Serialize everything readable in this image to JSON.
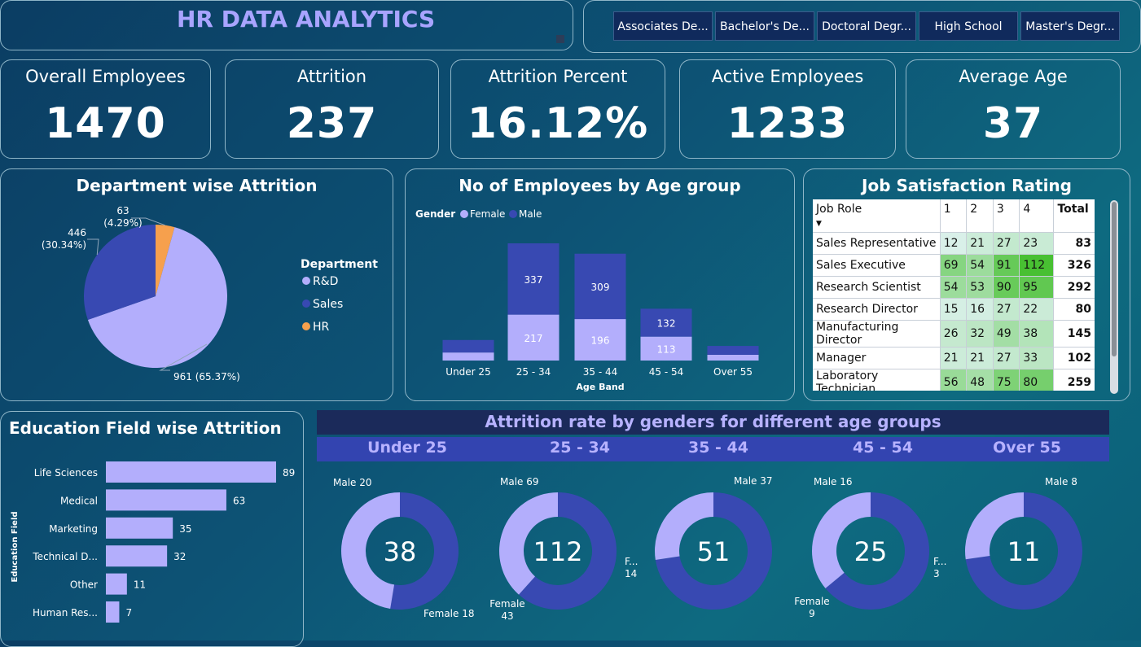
{
  "header": {
    "title": "HR DATA ANALYTICS"
  },
  "slicers": [
    "Associates De...",
    "Bachelor's De...",
    "Doctoral Degr...",
    "High School",
    "Master's Degr..."
  ],
  "kpis": [
    {
      "label": "Overall Employees",
      "value": "1470"
    },
    {
      "label": "Attrition",
      "value": "237"
    },
    {
      "label": "Attrition Percent",
      "value": "16.12%"
    },
    {
      "label": "Active Employees",
      "value": "1233"
    },
    {
      "label": "Average Age",
      "value": "37"
    }
  ],
  "colors": {
    "rnd": "#b3aefc",
    "sales": "#3849b2",
    "hr": "#f6a04d",
    "female": "#b3aefc",
    "male": "#3849b2"
  },
  "dept_title": "Department wise Attrition",
  "age_title": "No of Employees by Age group",
  "jobsat_title": "Job Satisfaction Rating",
  "edu_title": "Education Field wise Attrition",
  "gender_title": "Attrition rate by genders for different age groups",
  "chart_data": [
    {
      "type": "pie",
      "title": "Department wise Attrition",
      "legend_title": "Department",
      "slices": [
        {
          "name": "R&D",
          "value": 961,
          "label": "961 (65.37%)"
        },
        {
          "name": "Sales",
          "value": 446,
          "label": "446\n(30.34%)"
        },
        {
          "name": "HR",
          "value": 63,
          "label": "63\n(4.29%)"
        }
      ]
    },
    {
      "type": "bar",
      "stacked": true,
      "title": "No of Employees by Age group",
      "legend_title": "Gender",
      "xlabel": "Age Band",
      "categories": [
        "Under 25",
        "25 - 34",
        "35 - 44",
        "45 - 54",
        "Over 55"
      ],
      "series": [
        {
          "name": "Female",
          "values": [
            38,
            217,
            196,
            113,
            27
          ],
          "show_labels": [
            false,
            true,
            true,
            true,
            false
          ]
        },
        {
          "name": "Male",
          "values": [
            59,
            337,
            309,
            132,
            42
          ],
          "show_labels": [
            false,
            true,
            true,
            true,
            false
          ]
        }
      ]
    },
    {
      "type": "table",
      "title": "Job Satisfaction Rating",
      "columns": [
        "Job Role",
        "1",
        "2",
        "3",
        "4",
        "Total"
      ],
      "rows": [
        [
          "Sales Representative",
          12,
          21,
          27,
          23,
          83
        ],
        [
          "Sales Executive",
          69,
          54,
          91,
          112,
          326
        ],
        [
          "Research Scientist",
          54,
          53,
          90,
          95,
          292
        ],
        [
          "Research Director",
          15,
          16,
          27,
          22,
          80
        ],
        [
          "Manufacturing Director",
          26,
          32,
          49,
          38,
          145
        ],
        [
          "Manager",
          21,
          21,
          27,
          33,
          102
        ],
        [
          "Laboratory Technician",
          56,
          48,
          75,
          80,
          259
        ]
      ]
    },
    {
      "type": "bar",
      "orientation": "horizontal",
      "title": "Education Field wise Attrition",
      "ylabel": "Education Field",
      "categories": [
        "Life Sciences",
        "Medical",
        "Marketing",
        "Technical D...",
        "Other",
        "Human Res..."
      ],
      "values": [
        89,
        63,
        35,
        32,
        11,
        7
      ]
    },
    {
      "type": "pie",
      "variant": "donut",
      "title": "Attrition rate by genders for different age groups",
      "groups": [
        {
          "age": "Under 25",
          "total": "38",
          "male": 20,
          "female": 18,
          "male_label": "Male 20",
          "female_label": "Female 18"
        },
        {
          "age": "25 - 34",
          "total": "112",
          "male": 69,
          "female": 43,
          "male_label": "Male 69",
          "female_label": "Female\n43"
        },
        {
          "age": "35 - 44",
          "total": "51",
          "male": 37,
          "female": 14,
          "male_label": "Male 37",
          "female_label": "F...\n14"
        },
        {
          "age": "45 - 54",
          "total": "25",
          "male": 16,
          "female": 9,
          "male_label": "Male 16",
          "female_label": "Female\n9"
        },
        {
          "age": "Over 55",
          "total": "11",
          "male": 8,
          "female": 3,
          "male_label": "Male 8",
          "female_label": "F...\n3"
        }
      ]
    }
  ]
}
